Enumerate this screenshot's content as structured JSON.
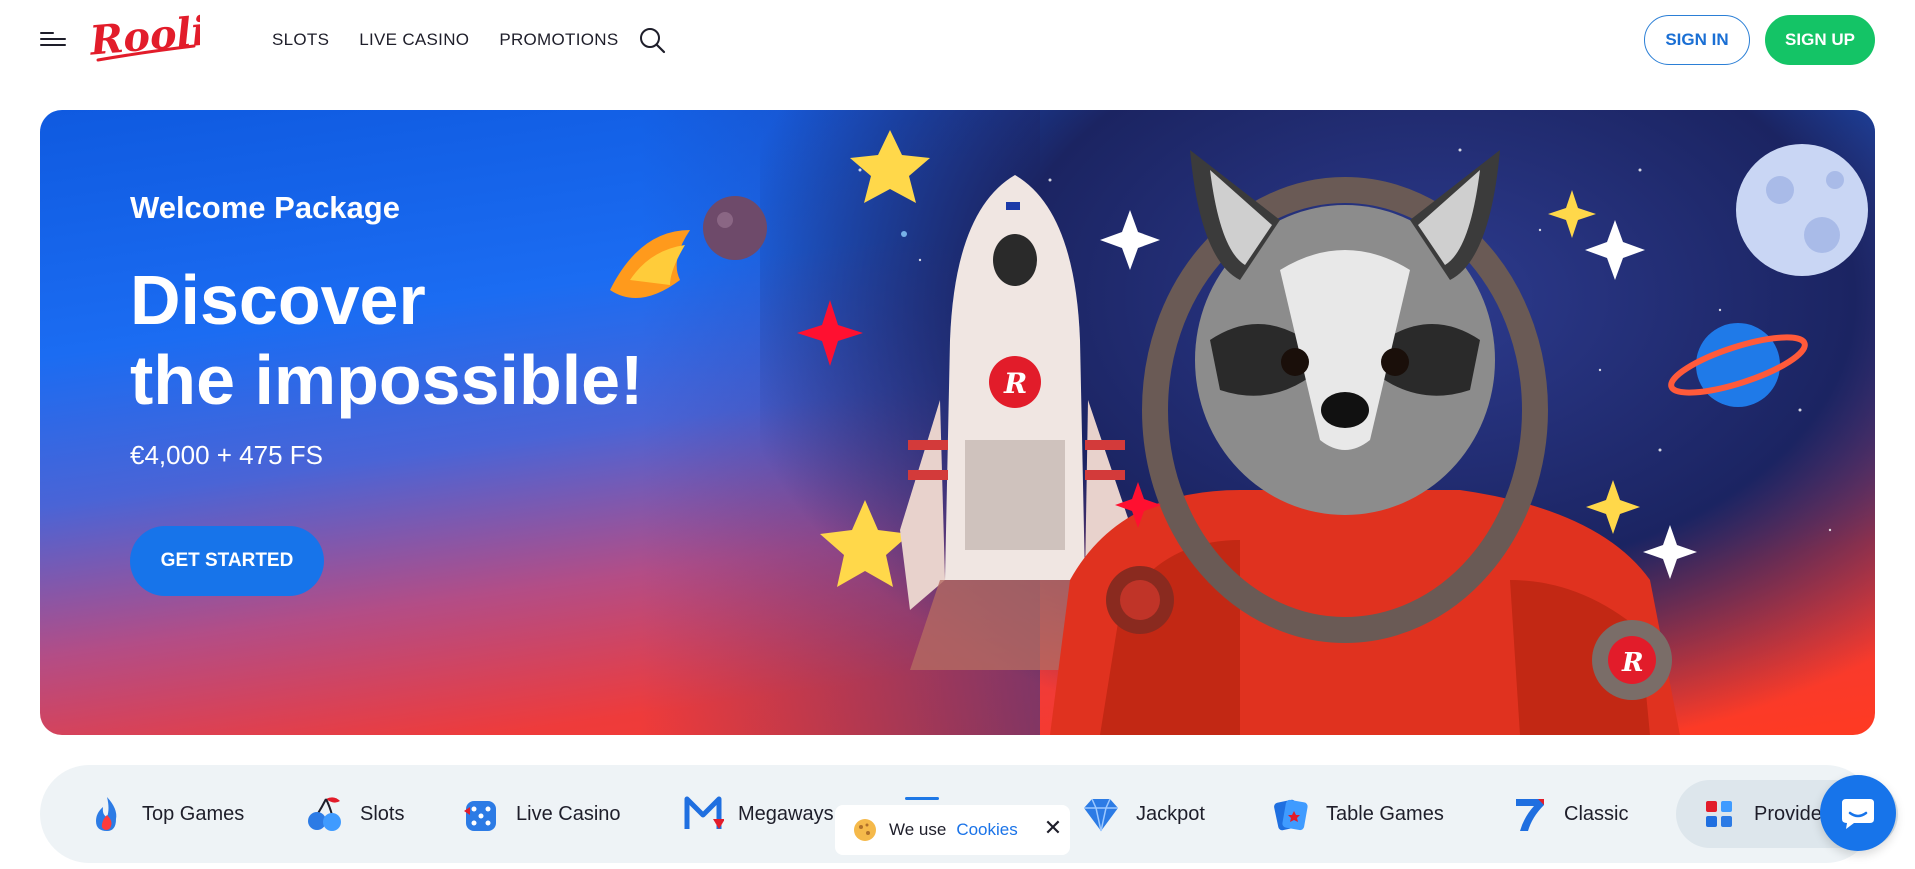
{
  "header": {
    "logo_text": "Rooli",
    "nav": [
      {
        "label": "SLOTS"
      },
      {
        "label": "LIVE CASINO"
      },
      {
        "label": "PROMOTIONS"
      }
    ],
    "signin_label": "SIGN IN",
    "signup_label": "SIGN UP",
    "icons": [
      "menu-icon",
      "search-icon"
    ]
  },
  "hero": {
    "subtitle": "Welcome Package",
    "title_line1": "Discover",
    "title_line2": "the impossible!",
    "offer": "€4,000 + 475 FS",
    "cta_label": "GET STARTED",
    "badge_letter": "R"
  },
  "categories": [
    {
      "label": "Top Games",
      "icon": "flame-icon"
    },
    {
      "label": "Slots",
      "icon": "cherries-icon"
    },
    {
      "label": "Live Casino",
      "icon": "dice-icon"
    },
    {
      "label": "Megaways",
      "icon": "megaways-icon"
    },
    {
      "label": "Jackpot",
      "icon": "diamond-icon"
    },
    {
      "label": "Table Games",
      "icon": "cards-icon"
    },
    {
      "label": "Classic",
      "icon": "seven-icon"
    },
    {
      "label": "Providers",
      "icon": "providers-icon"
    }
  ],
  "cookie": {
    "text": "We use",
    "link": "Cookies",
    "close": "✕"
  },
  "colors": {
    "brand_red": "#e21c2a",
    "signup_green": "#14c466",
    "primary_blue": "#1774ea",
    "link_blue": "#1a73e8"
  }
}
